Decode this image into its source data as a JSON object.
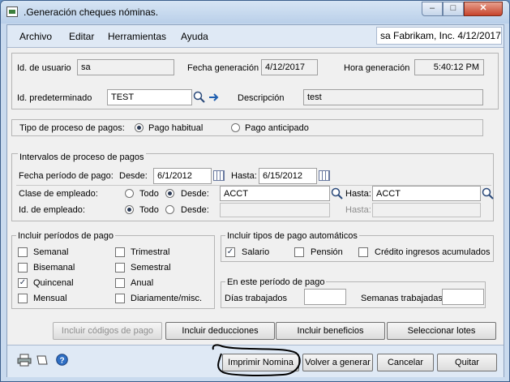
{
  "window": {
    "title": ".Generación cheques nóminas.",
    "min_glyph": "–",
    "max_glyph": "□",
    "close_glyph": "✕"
  },
  "menu": {
    "items": [
      "Archivo",
      "Editar",
      "Herramientas",
      "Ayuda"
    ],
    "company": "sa  Fabrikam, Inc.  4/12/2017"
  },
  "header": {
    "user_id_label": "Id. de usuario",
    "user_id": "sa",
    "gen_date_label": "Fecha generación",
    "gen_date": "4/12/2017",
    "gen_time_label": "Hora generación",
    "gen_time": "5:40:12 PM",
    "default_id_label": "Id. predeterminado",
    "default_id": "TEST",
    "description_label": "Descripción",
    "description": "test"
  },
  "payment_type": {
    "label": "Tipo de proceso de pagos:",
    "option_regular": "Pago habitual",
    "option_advance": "Pago anticipado",
    "selected": "Pago habitual"
  },
  "intervals": {
    "title": "Intervalos de proceso de pagos",
    "period_label": "Fecha período de pago:",
    "from_label": "Desde:",
    "from_date": "6/1/2012",
    "to_label": "Hasta:",
    "to_date": "6/15/2012",
    "class_label": "Clase de empleado:",
    "all_label": "Todo",
    "from_radio_label": "Desde:",
    "class_from": "ACCT",
    "class_to_label": "Hasta:",
    "class_to": "ACCT",
    "emp_label": "Id. de empleado:",
    "emp_all_label": "Todo",
    "emp_from_label": "Desde:",
    "emp_to_label": "Hasta:"
  },
  "pay_periods": {
    "title": "Incluir períodos de pago",
    "left": [
      {
        "label": "Semanal",
        "checked": false
      },
      {
        "label": "Bisemanal",
        "checked": false
      },
      {
        "label": "Quincenal",
        "checked": true
      },
      {
        "label": "Mensual",
        "checked": false
      }
    ],
    "right": [
      {
        "label": "Trimestral",
        "checked": false
      },
      {
        "label": "Semestral",
        "checked": false
      },
      {
        "label": "Anual",
        "checked": false
      },
      {
        "label": "Diariamente/misc.",
        "checked": false
      }
    ]
  },
  "auto_pay": {
    "title": "Incluir tipos de pago automáticos",
    "items": [
      {
        "label": "Salario",
        "checked": true
      },
      {
        "label": "Pensión",
        "checked": false
      },
      {
        "label": "Crédito ingresos acumulados",
        "checked": false
      }
    ]
  },
  "period_box": {
    "title": "En este período de pago",
    "days_label": "Días trabajados",
    "weeks_label": "Semanas trabajadas",
    "days": "",
    "weeks": ""
  },
  "buttons": {
    "pay_codes": "Incluir códigos de pago",
    "deductions": "Incluir deducciones",
    "benefits": "Incluir beneficios",
    "batches": "Seleccionar lotes",
    "print": "Imprimir Nomina",
    "back": "Volver a generar",
    "cancel": "Cancelar",
    "quit": "Quitar"
  },
  "check_glyph": "✓"
}
